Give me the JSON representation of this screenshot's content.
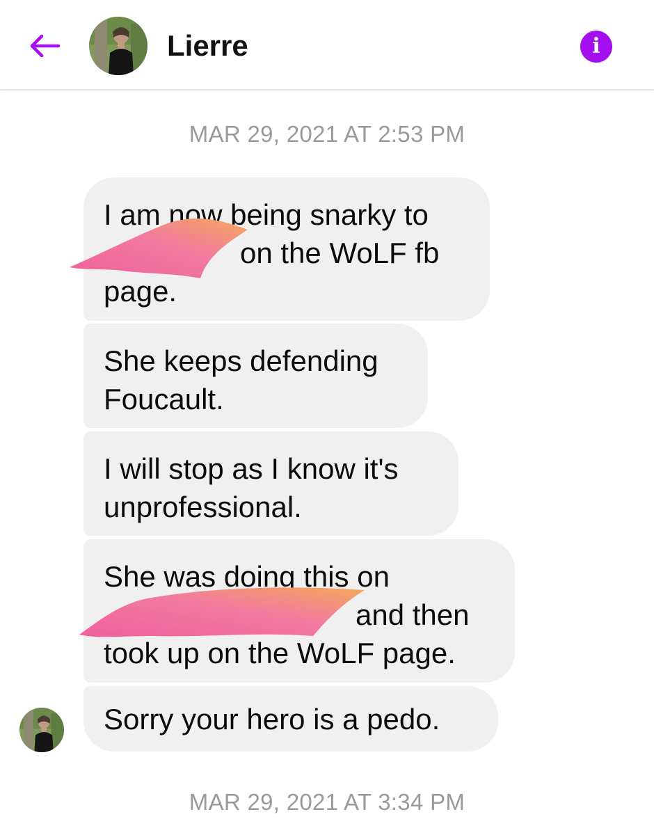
{
  "header": {
    "contact_name": "Lierre",
    "back_icon": "arrow-left-icon",
    "info_icon": "info-icon",
    "info_glyph": "i",
    "accent_color": "#a40ff0"
  },
  "timestamps": {
    "first": "MAR 29, 2021 AT 2:53 PM",
    "second": "MAR 29, 2021 AT 3:34 PM"
  },
  "messages": [
    {
      "lines": [
        "I am now being snarky to",
        "on the WoLF fb",
        "page."
      ],
      "redacted": true
    },
    {
      "lines": [
        "She keeps defending",
        "Foucault."
      ],
      "redacted": false
    },
    {
      "lines": [
        "I will stop as I know it's",
        "unprofessional."
      ],
      "redacted": false
    },
    {
      "lines": [
        "She was doing this on",
        "and then",
        "took up on the WoLF page."
      ],
      "redacted": true
    },
    {
      "lines": [
        "Sorry your hero is a pedo."
      ],
      "redacted": false
    }
  ],
  "colors": {
    "bubble_background": "#f0f0f0",
    "timestamp_text": "#9a9a9a",
    "redaction_pink": "#f0609c",
    "redaction_orange": "#f4a85a"
  }
}
